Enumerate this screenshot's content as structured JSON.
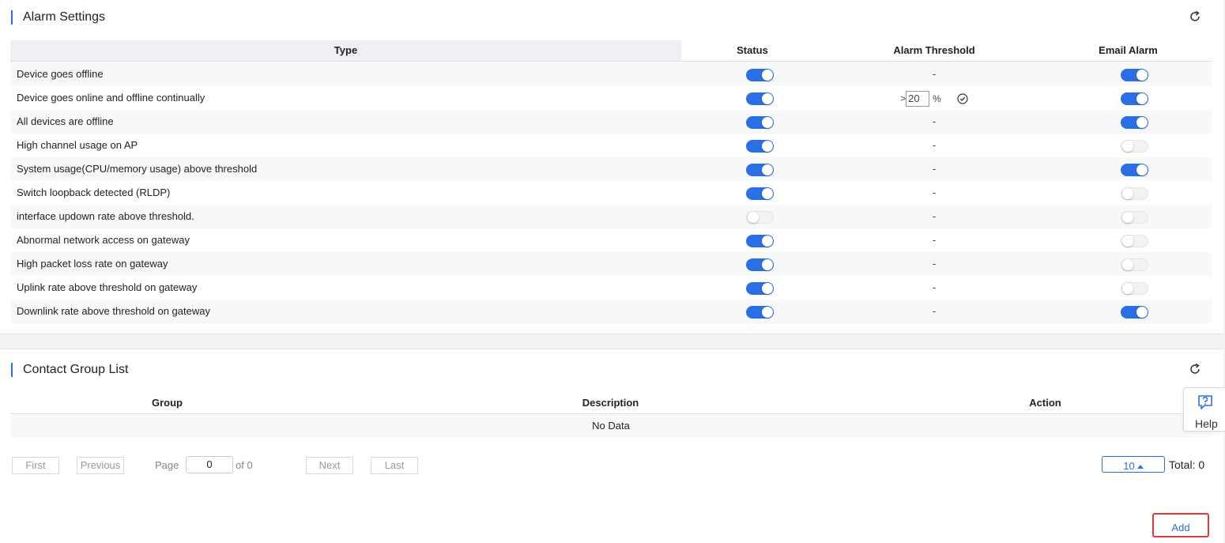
{
  "alarm_settings": {
    "title": "Alarm Settings",
    "columns": {
      "type": "Type",
      "status": "Status",
      "threshold": "Alarm Threshold",
      "email": "Email Alarm"
    },
    "rows": [
      {
        "type": "Device goes offline",
        "status": true,
        "threshold": "-",
        "email": true
      },
      {
        "type": "Device goes online and offline continually",
        "status": true,
        "threshold_prefix": ">",
        "threshold_value": "20",
        "threshold_unit": "%",
        "email": true
      },
      {
        "type": "All devices are offline",
        "status": true,
        "threshold": "-",
        "email": true
      },
      {
        "type": "High channel usage on AP",
        "status": true,
        "threshold": "-",
        "email": false
      },
      {
        "type": "System usage(CPU/memory usage) above threshold",
        "status": true,
        "threshold": "-",
        "email": true
      },
      {
        "type": "Switch loopback detected (RLDP)",
        "status": true,
        "threshold": "-",
        "email": false
      },
      {
        "type": "interface updown rate above threshold.",
        "status": false,
        "threshold": "-",
        "email": false
      },
      {
        "type": "Abnormal network access on gateway",
        "status": true,
        "threshold": "-",
        "email": false
      },
      {
        "type": "High packet loss rate on gateway",
        "status": true,
        "threshold": "-",
        "email": false
      },
      {
        "type": "Uplink rate above threshold on gateway",
        "status": true,
        "threshold": "-",
        "email": false
      },
      {
        "type": "Downlink rate above threshold on gateway",
        "status": true,
        "threshold": "-",
        "email": true
      }
    ]
  },
  "contact_group": {
    "title": "Contact Group List",
    "columns": {
      "group": "Group",
      "description": "Description",
      "action": "Action"
    },
    "empty_text": "No Data"
  },
  "pagination": {
    "first": "First",
    "previous": "Previous",
    "page_label": "Page",
    "page_value": "0",
    "of_label": "of 0",
    "next": "Next",
    "last": "Last",
    "page_size": "10",
    "total": "Total: 0"
  },
  "add_button": "Add",
  "help_label": "Help",
  "colors": {
    "accent": "#2b6fe8",
    "highlight_border": "#e03a3a"
  }
}
